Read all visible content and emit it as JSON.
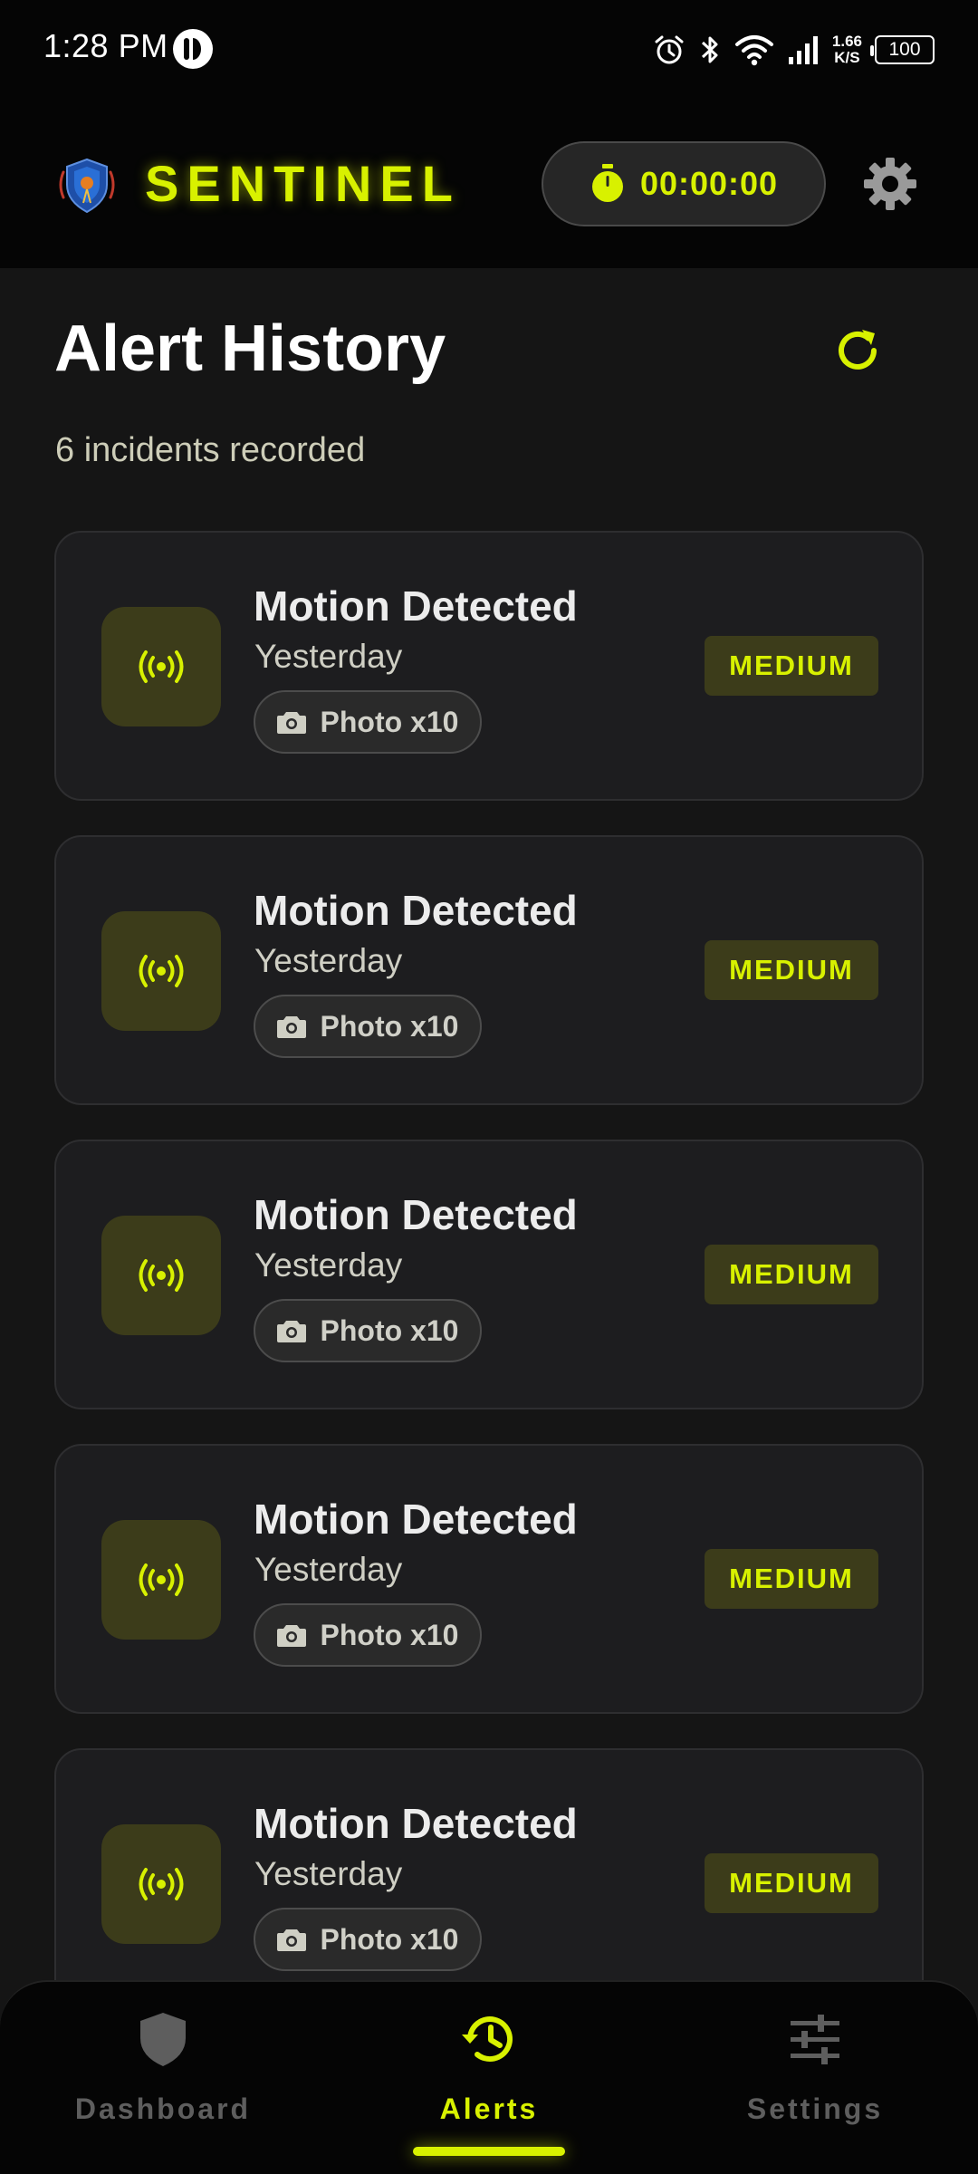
{
  "status_bar": {
    "time": "1:28 PM",
    "net_speed_value": "1.66",
    "net_speed_unit": "K/S",
    "battery": "100"
  },
  "header": {
    "brand": "SENTINEL",
    "timer": "00:00:00"
  },
  "page": {
    "title": "Alert History",
    "subtitle": "6 incidents recorded"
  },
  "alerts": [
    {
      "title": "Motion Detected",
      "time": "Yesterday",
      "attachment": "Photo x10",
      "severity": "MEDIUM"
    },
    {
      "title": "Motion Detected",
      "time": "Yesterday",
      "attachment": "Photo x10",
      "severity": "MEDIUM"
    },
    {
      "title": "Motion Detected",
      "time": "Yesterday",
      "attachment": "Photo x10",
      "severity": "MEDIUM"
    },
    {
      "title": "Motion Detected",
      "time": "Yesterday",
      "attachment": "Photo x10",
      "severity": "MEDIUM"
    },
    {
      "title": "Motion Detected",
      "time": "Yesterday",
      "attachment": "Photo x10",
      "severity": "MEDIUM"
    }
  ],
  "nav": {
    "items": [
      {
        "label": "Dashboard",
        "icon": "shield-icon",
        "active": false
      },
      {
        "label": "Alerts",
        "icon": "history-icon",
        "active": true
      },
      {
        "label": "Settings",
        "icon": "sliders-icon",
        "active": false
      }
    ]
  },
  "colors": {
    "accent": "#d8f100",
    "background": "#151515",
    "card": "#1d1d1f",
    "badge_bg": "#3c3c1a"
  }
}
